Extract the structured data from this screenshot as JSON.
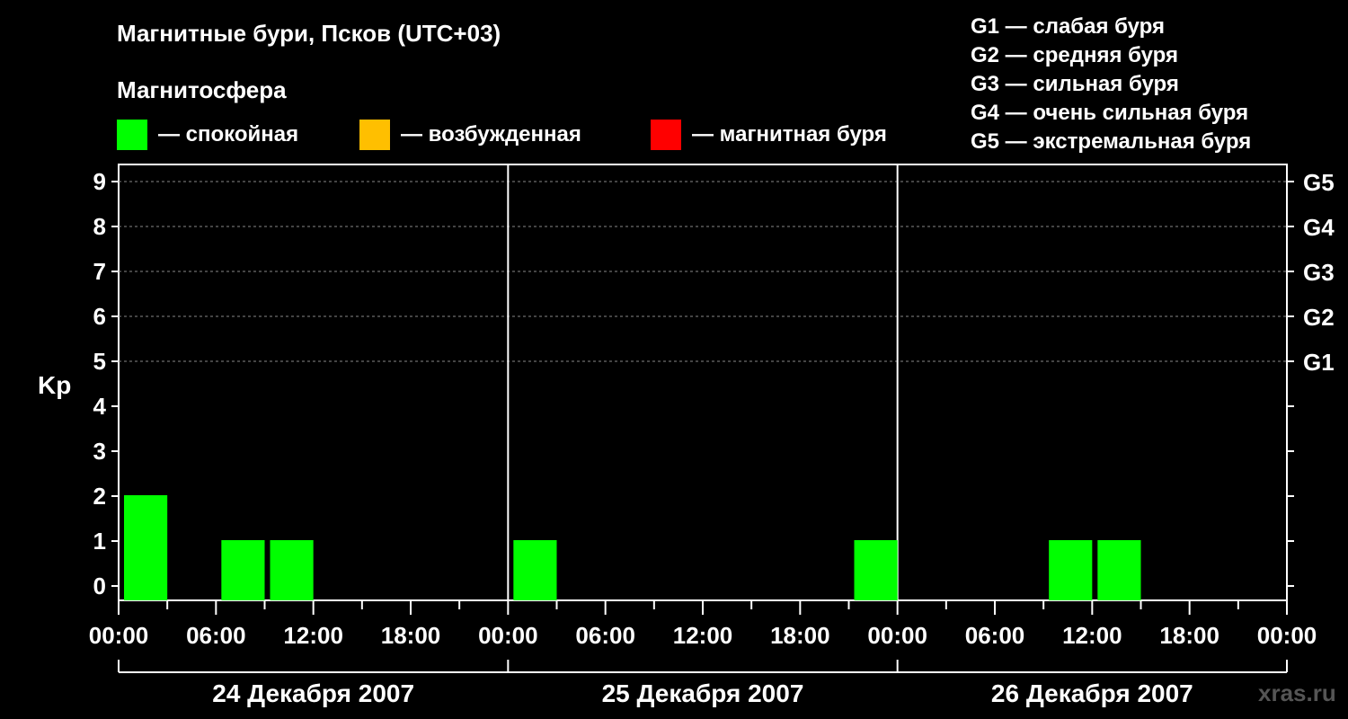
{
  "header": {
    "title": "Магнитные бури, Псков (UTC+03)",
    "subtitle": "Магнитосфера"
  },
  "legend": [
    {
      "label": "— спокойная",
      "color": "#00ff00"
    },
    {
      "label": "— возбужденная",
      "color": "#ffbf00"
    },
    {
      "label": "— магнитная буря",
      "color": "#ff0000"
    }
  ],
  "g_legend": [
    "G1 — слабая буря",
    "G2 — средняя буря",
    "G3 — сильная буря",
    "G4 — очень сильная буря",
    "G5 — экстремальная буря"
  ],
  "watermark": "xras.ru",
  "chart_data": {
    "type": "bar",
    "ylabel": "Kp",
    "ylim": [
      0,
      9
    ],
    "yticks": [
      0,
      1,
      2,
      3,
      4,
      5,
      6,
      7,
      8,
      9
    ],
    "g_ticks": [
      {
        "value": 5,
        "label": "G1"
      },
      {
        "value": 6,
        "label": "G2"
      },
      {
        "value": 7,
        "label": "G3"
      },
      {
        "value": 8,
        "label": "G4"
      },
      {
        "value": 9,
        "label": "G5"
      }
    ],
    "x_tick_labels": [
      "00:00",
      "06:00",
      "12:00",
      "18:00",
      "00:00",
      "06:00",
      "12:00",
      "18:00",
      "00:00",
      "06:00",
      "12:00",
      "18:00",
      "00:00"
    ],
    "days": [
      "24 Декабря 2007",
      "25 Декабря 2007",
      "26 Декабря 2007"
    ],
    "bin_hours": 3,
    "values": [
      2,
      0,
      1,
      1,
      0,
      0,
      0,
      0,
      1,
      0,
      0,
      0,
      0,
      0,
      0,
      1,
      0,
      0,
      0,
      1,
      1,
      0,
      0,
      0
    ],
    "thresholds": {
      "quiet_max": 3,
      "active_max": 4
    },
    "colors": {
      "quiet": "#00ff00",
      "active": "#ffbf00",
      "storm": "#ff0000"
    },
    "grid": true
  }
}
